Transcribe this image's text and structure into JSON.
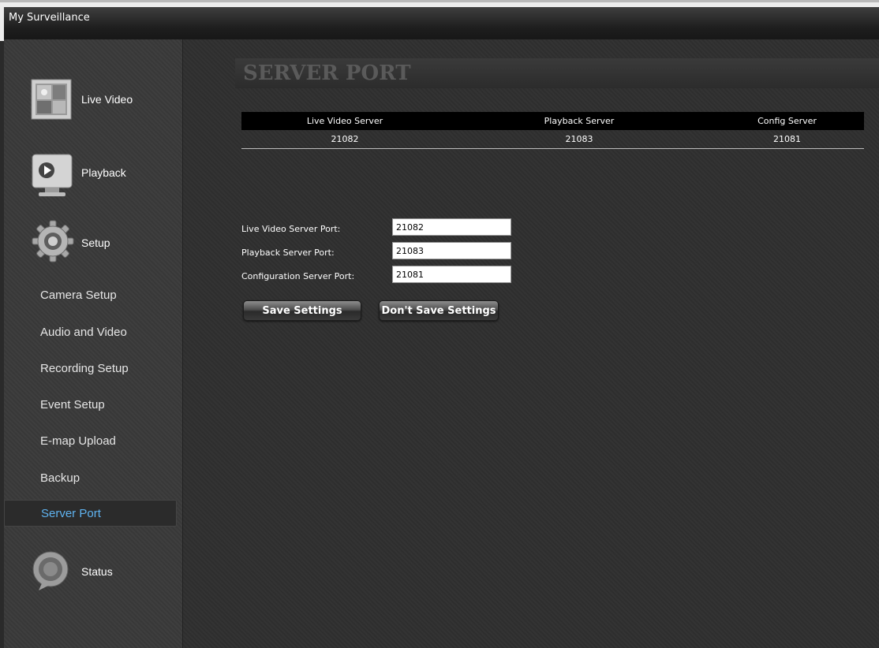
{
  "window": {
    "title": "My Surveillance"
  },
  "sidebar": {
    "main_items": [
      {
        "label": "Live Video",
        "icon": "live-video-icon"
      },
      {
        "label": "Playback",
        "icon": "playback-icon"
      },
      {
        "label": "Setup",
        "icon": "gear-icon"
      },
      {
        "label": "Status",
        "icon": "status-icon"
      }
    ],
    "setup_items": [
      {
        "label": "Camera Setup"
      },
      {
        "label": "Audio and Video"
      },
      {
        "label": "Recording Setup"
      },
      {
        "label": "Event Setup"
      },
      {
        "label": "E-map Upload"
      },
      {
        "label": "Backup"
      },
      {
        "label": "Server Port"
      }
    ],
    "active_item": "Server Port"
  },
  "main": {
    "heading": "SERVER PORT",
    "table": {
      "headers": [
        "Live Video Server",
        "Playback Server",
        "Config Server"
      ],
      "values": [
        "21082",
        "21083",
        "21081"
      ]
    },
    "form": {
      "live_label": "Live Video Server Port:",
      "live_value": "21082",
      "playback_label": "Playback Server Port:",
      "playback_value": "21083",
      "config_label": "Configuration Server Port:",
      "config_value": "21081"
    },
    "buttons": {
      "save": "Save Settings",
      "dont_save": "Don't Save Settings"
    }
  },
  "colors": {
    "active_item": "#5fb3f0",
    "panel_bg": "#303030"
  }
}
